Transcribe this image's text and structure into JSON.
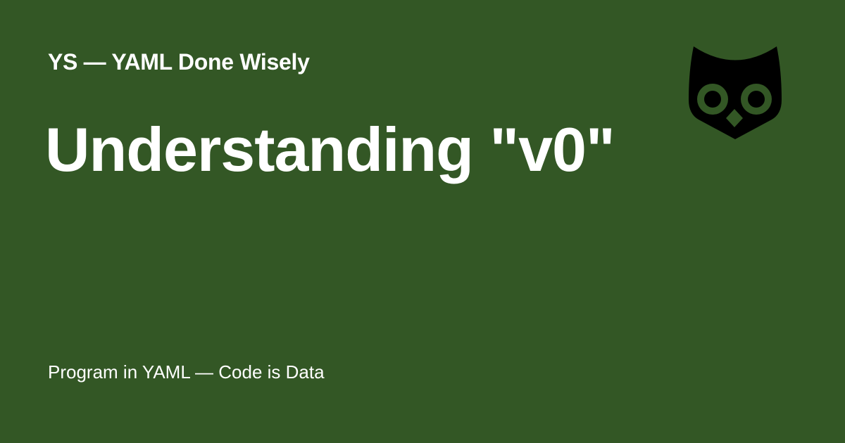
{
  "header": {
    "site_title": "YS — YAML Done Wisely"
  },
  "main": {
    "title": "Understanding \"v0\""
  },
  "footer": {
    "tagline": "Program in YAML — Code is Data"
  },
  "logo": {
    "icon": "owl-icon"
  },
  "colors": {
    "background": "#335725",
    "text": "#ffffff",
    "logo": "#000000"
  }
}
